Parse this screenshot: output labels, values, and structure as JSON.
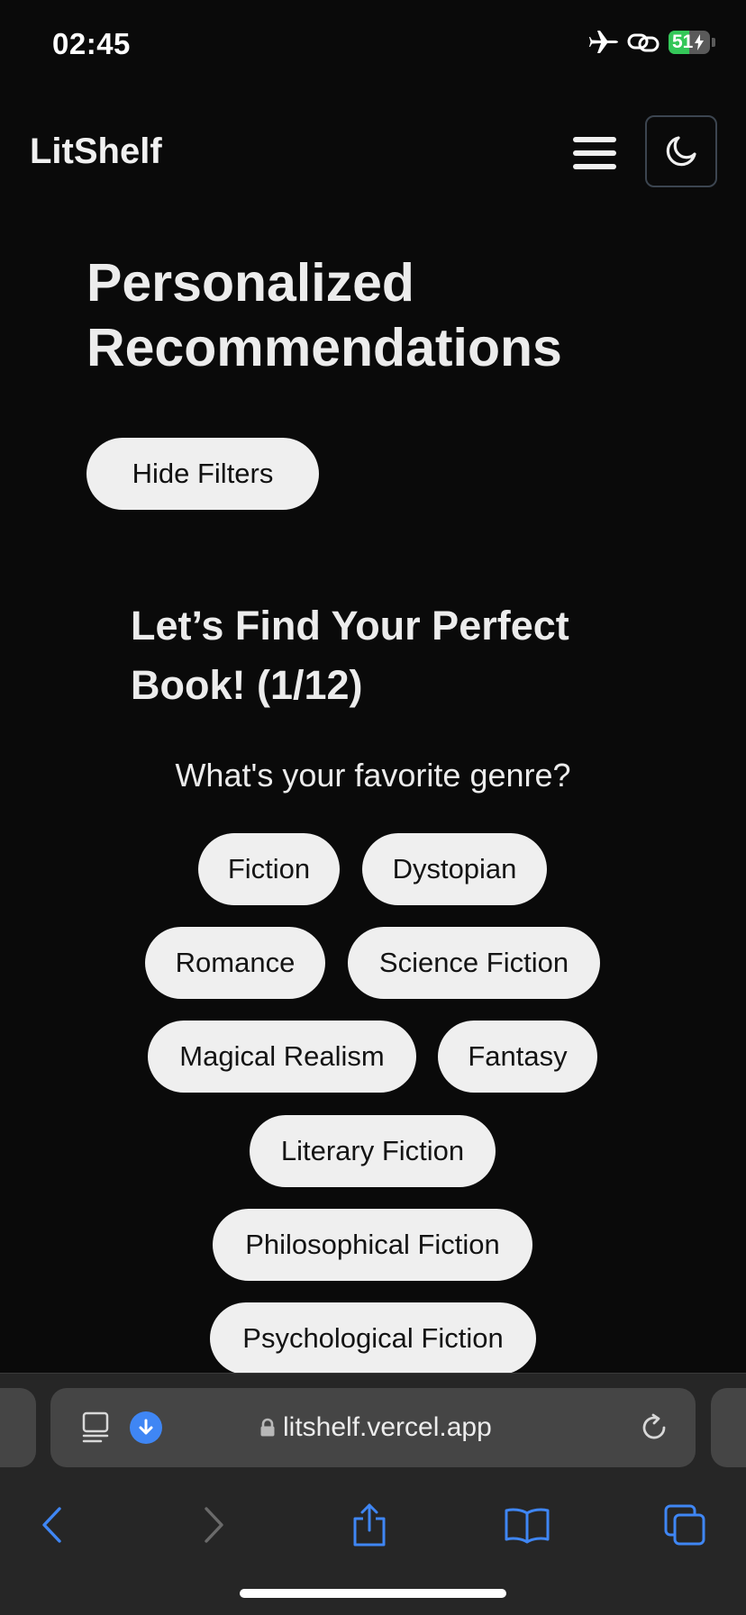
{
  "status": {
    "time": "02:45",
    "battery": "51",
    "battery_level": 0.51
  },
  "header": {
    "logo": "LitShelf",
    "menu_icon": "hamburger-menu-icon",
    "theme_icon": "moon-icon"
  },
  "main": {
    "title": "Personalized Recommendations",
    "hide_filters": "Hide Filters",
    "quiz": {
      "title": "Let’s Find Your Perfect Book! (1/12)",
      "question": "What's your favorite genre?",
      "options": [
        "Fiction",
        "Dystopian",
        "Romance",
        "Science Fiction",
        "Magical Realism",
        "Fantasy",
        "Literary Fiction",
        "Philosophical Fiction",
        "Psychological Fiction"
      ]
    }
  },
  "browser": {
    "url": "litshelf.vercel.app",
    "icons": [
      "tab-overview-icon",
      "download-icon",
      "lock-icon",
      "reload-icon",
      "back-icon",
      "forward-icon",
      "share-icon",
      "bookmarks-icon",
      "tabs-icon"
    ],
    "accent_color": "#3f86f4"
  }
}
